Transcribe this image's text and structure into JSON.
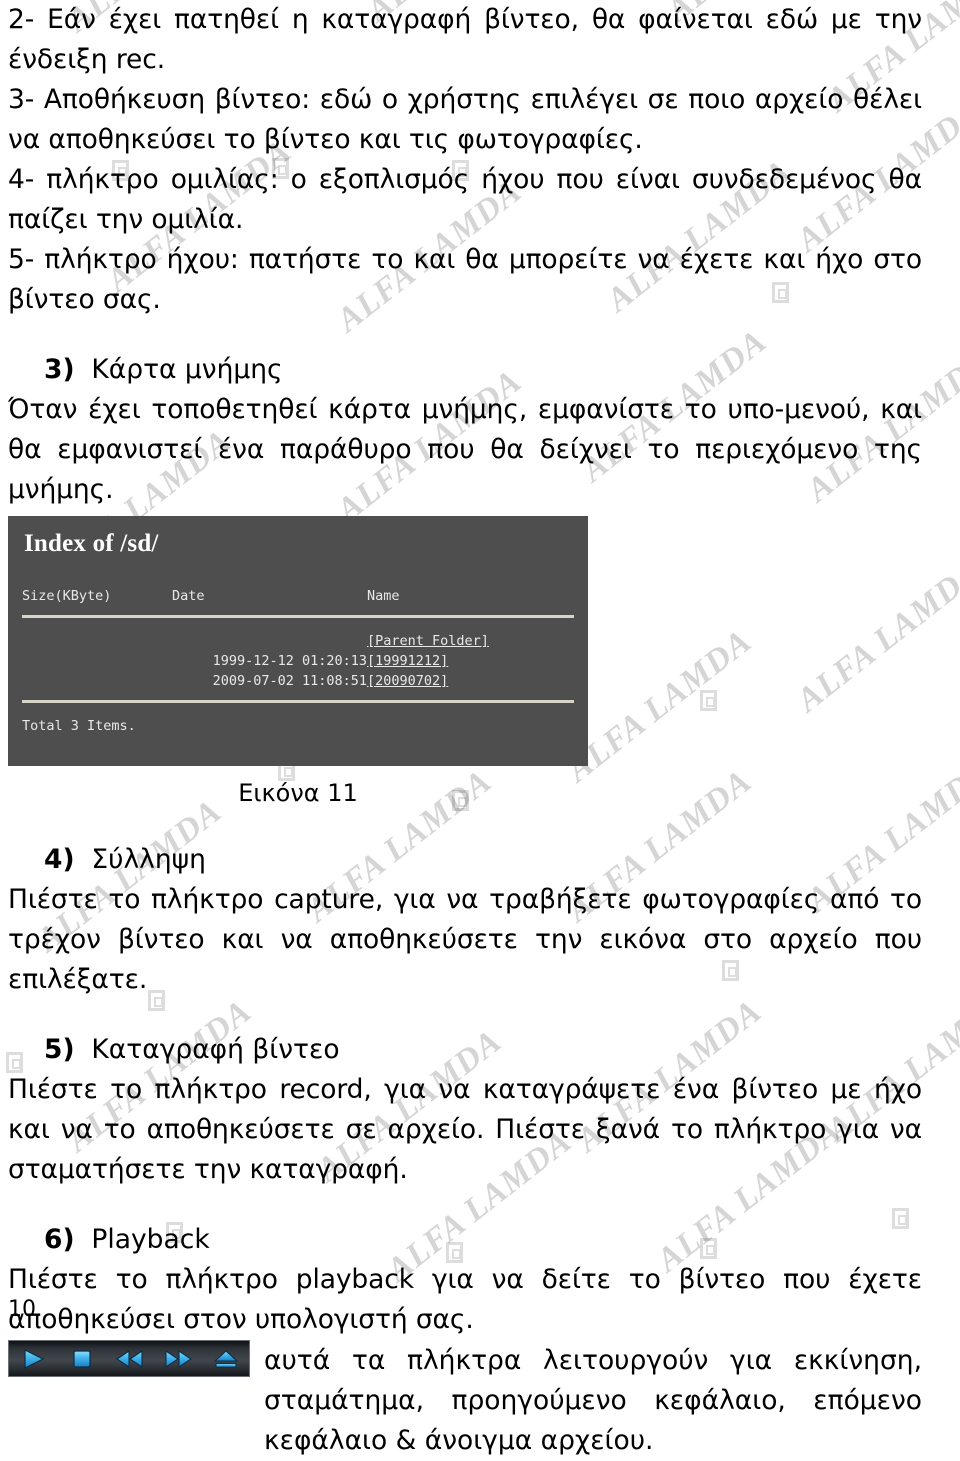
{
  "document": {
    "page_number": "10",
    "watermark_text": "ALFA LAMDA"
  },
  "intro_items": [
    {
      "id": "item-2",
      "text": "2- Εάν έχει πατηθεί η καταγραφή βίντεο, θα φαίνεται εδώ με την ένδειξη rec."
    },
    {
      "id": "item-3",
      "text": "3- Αποθήκευση βίντεο: εδώ ο χρήστης επιλέγει σε ποιο αρχείο θέλει να αποθηκεύσει το βίντεο και τις φωτογραφίες."
    },
    {
      "id": "item-4",
      "text": "4- πλήκτρο ομιλίας: ο εξοπλισμός ήχου που είναι συνδεδεμένος θα παίζει την ομιλία."
    },
    {
      "id": "item-5",
      "text": "5- πλήκτρο ήχου: πατήστε το και θα μπορείτε να έχετε και ήχο στο βίντεο σας."
    }
  ],
  "sections": [
    {
      "number": "3)",
      "title": "Κάρτα μνήμης",
      "body": "Όταν έχει τοποθετηθεί κάρτα μνήμης, εμφανίστε το υπο-μενού, και θα εμφανιστεί ένα παράθυρο που θα δείχνει το περιεχόμενο της μνήμης."
    },
    {
      "number": "4)",
      "title": "Σύλληψη",
      "body": "Πιέστε το πλήκτρο capture, για να τραβήξετε φωτογραφίες από το τρέχον βίντεο και να αποθηκεύσετε την εικόνα στο αρχείο που επιλέξατε."
    },
    {
      "number": "5)",
      "title": "Καταγραφή βίντεο",
      "body": "Πιέστε το πλήκτρο record, για να καταγράψετε ένα βίντεο με ήχο και να το αποθηκεύσετε σε αρχείο. Πιέστε ξανά το πλήκτρο για να σταματήσετε την καταγραφή."
    },
    {
      "number": "6)",
      "title": "Playback",
      "body": "Πιέστε το πλήκτρο playback για να δείτε το βίντεο που έχετε αποθηκεύσει στον υπολογιστή σας."
    }
  ],
  "index_panel": {
    "title": "Index of /sd/",
    "columns": {
      "size": "Size(KByte)",
      "date": "Date",
      "name": "Name"
    },
    "rows": [
      {
        "size": "",
        "date": "",
        "name": "[Parent Folder]"
      },
      {
        "size": "",
        "date": "1999-12-12 01:20:13",
        "name": "[19991212]"
      },
      {
        "size": "",
        "date": "2009-07-02 11:08:51",
        "name": "[20090702]"
      }
    ],
    "total": "Total 3 Items."
  },
  "figure_caption": "Εικόνα 11",
  "playback": {
    "buttons": [
      {
        "name": "play",
        "label": "play"
      },
      {
        "name": "stop",
        "label": "stop"
      },
      {
        "name": "rewind",
        "label": "previous chapter"
      },
      {
        "name": "forward",
        "label": "next chapter"
      },
      {
        "name": "eject",
        "label": "open file"
      }
    ],
    "icon_color": "#3fb4ea",
    "description": "αυτά τα πλήκτρα λειτουργούν για εκκίνηση, σταμάτημα, προηγούμενο κεφάλαιο, επόμενο κεφάλαιο & άνοιγμα αρχείου."
  }
}
